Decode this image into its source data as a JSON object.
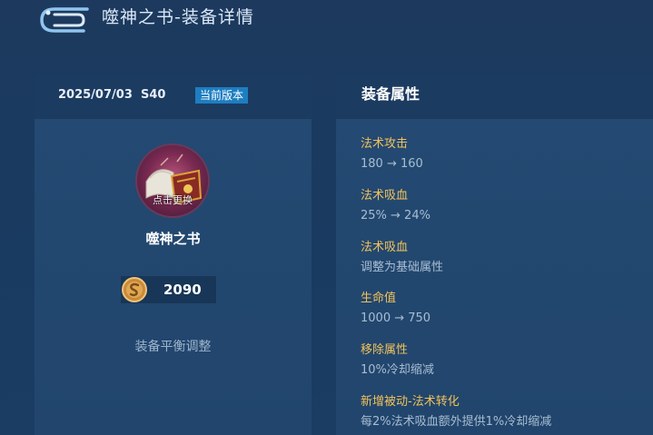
{
  "header": {
    "title": "噬神之书-装备详情"
  },
  "left": {
    "date": "2025/07/03",
    "season": "S40",
    "version_badge": "当前版本",
    "icon_label": "点击更换",
    "item_name": "噬神之书",
    "price": "2090",
    "note": "装备平衡调整"
  },
  "right": {
    "title": "装备属性",
    "attributes": [
      {
        "name": "法术攻击",
        "value": "180 → 160"
      },
      {
        "name": "法术吸血",
        "value": "25% → 24%"
      },
      {
        "name": "法术吸血",
        "value": "调整为基础属性"
      },
      {
        "name": "生命值",
        "value": "1000 → 750"
      },
      {
        "name": "移除属性",
        "value": "10%冷却缩减"
      },
      {
        "name": "新增被动-法术转化",
        "value": "每2%法术吸血额外提供1%冷却缩减"
      }
    ]
  },
  "colors": {
    "attr_name": "#f2c25a",
    "attr_value": "#a9bdd3",
    "badge": "#1d7ec2",
    "background": "#1d3a5e"
  },
  "icons": [
    "back-icon",
    "book-icon",
    "coin-icon"
  ]
}
